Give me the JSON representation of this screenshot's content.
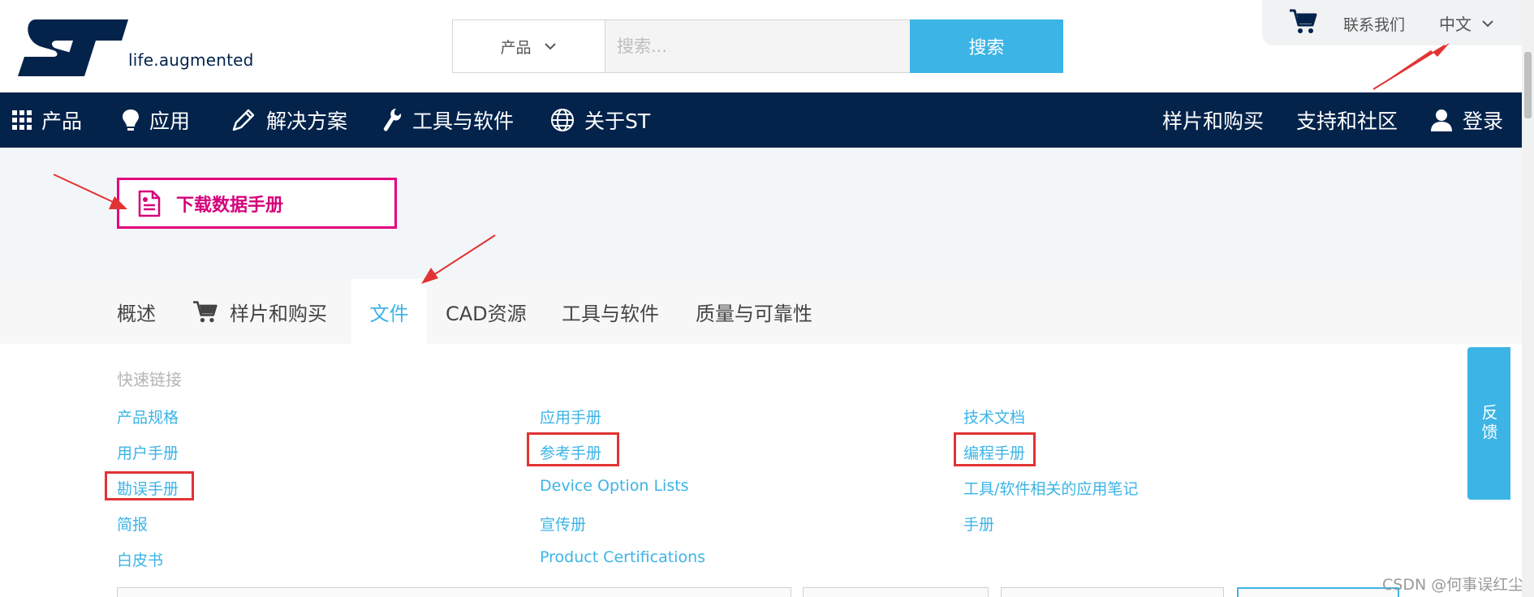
{
  "header": {
    "logo_tagline": "life.augmented",
    "search": {
      "category": "产品",
      "placeholder": "搜索...",
      "button": "搜索"
    },
    "contact": "联系我们",
    "language": "中文"
  },
  "mainnav": {
    "left": [
      {
        "label": "产品",
        "icon": "grid-icon"
      },
      {
        "label": "应用",
        "icon": "lightbulb-icon"
      },
      {
        "label": "解决方案",
        "icon": "pencil-icon"
      },
      {
        "label": "工具与软件",
        "icon": "wrench-icon"
      },
      {
        "label": "关于ST",
        "icon": "globe-icon"
      }
    ],
    "right": [
      {
        "label": "样片和购买"
      },
      {
        "label": "支持和社区"
      },
      {
        "label": "登录",
        "icon": "user-icon"
      }
    ]
  },
  "hero": {
    "datasheet_button": "下载数据手册"
  },
  "tabs": [
    {
      "label": "概述"
    },
    {
      "label": "样片和购买",
      "icon": "cart-icon"
    },
    {
      "label": "文件",
      "active": true
    },
    {
      "label": "CAD资源"
    },
    {
      "label": "工具与软件"
    },
    {
      "label": "质量与可靠性"
    }
  ],
  "quicklinks": {
    "title": "快速链接",
    "col1": [
      "产品规格",
      "用户手册",
      "勘误手册",
      "简报",
      "白皮书"
    ],
    "col2": [
      "应用手册",
      "参考手册",
      "Device Option Lists",
      "宣传册",
      "Product Certifications"
    ],
    "col3": [
      "技术文档",
      "编程手册",
      "工具/软件相关的应用笔记",
      "手册"
    ]
  },
  "feedback": "反馈",
  "watermark": "CSDN @何事误红尘",
  "colors": {
    "navy": "#03234b",
    "accent": "#3cb4e6",
    "magenta": "#e4007f",
    "annotation_red": "#e23333"
  }
}
